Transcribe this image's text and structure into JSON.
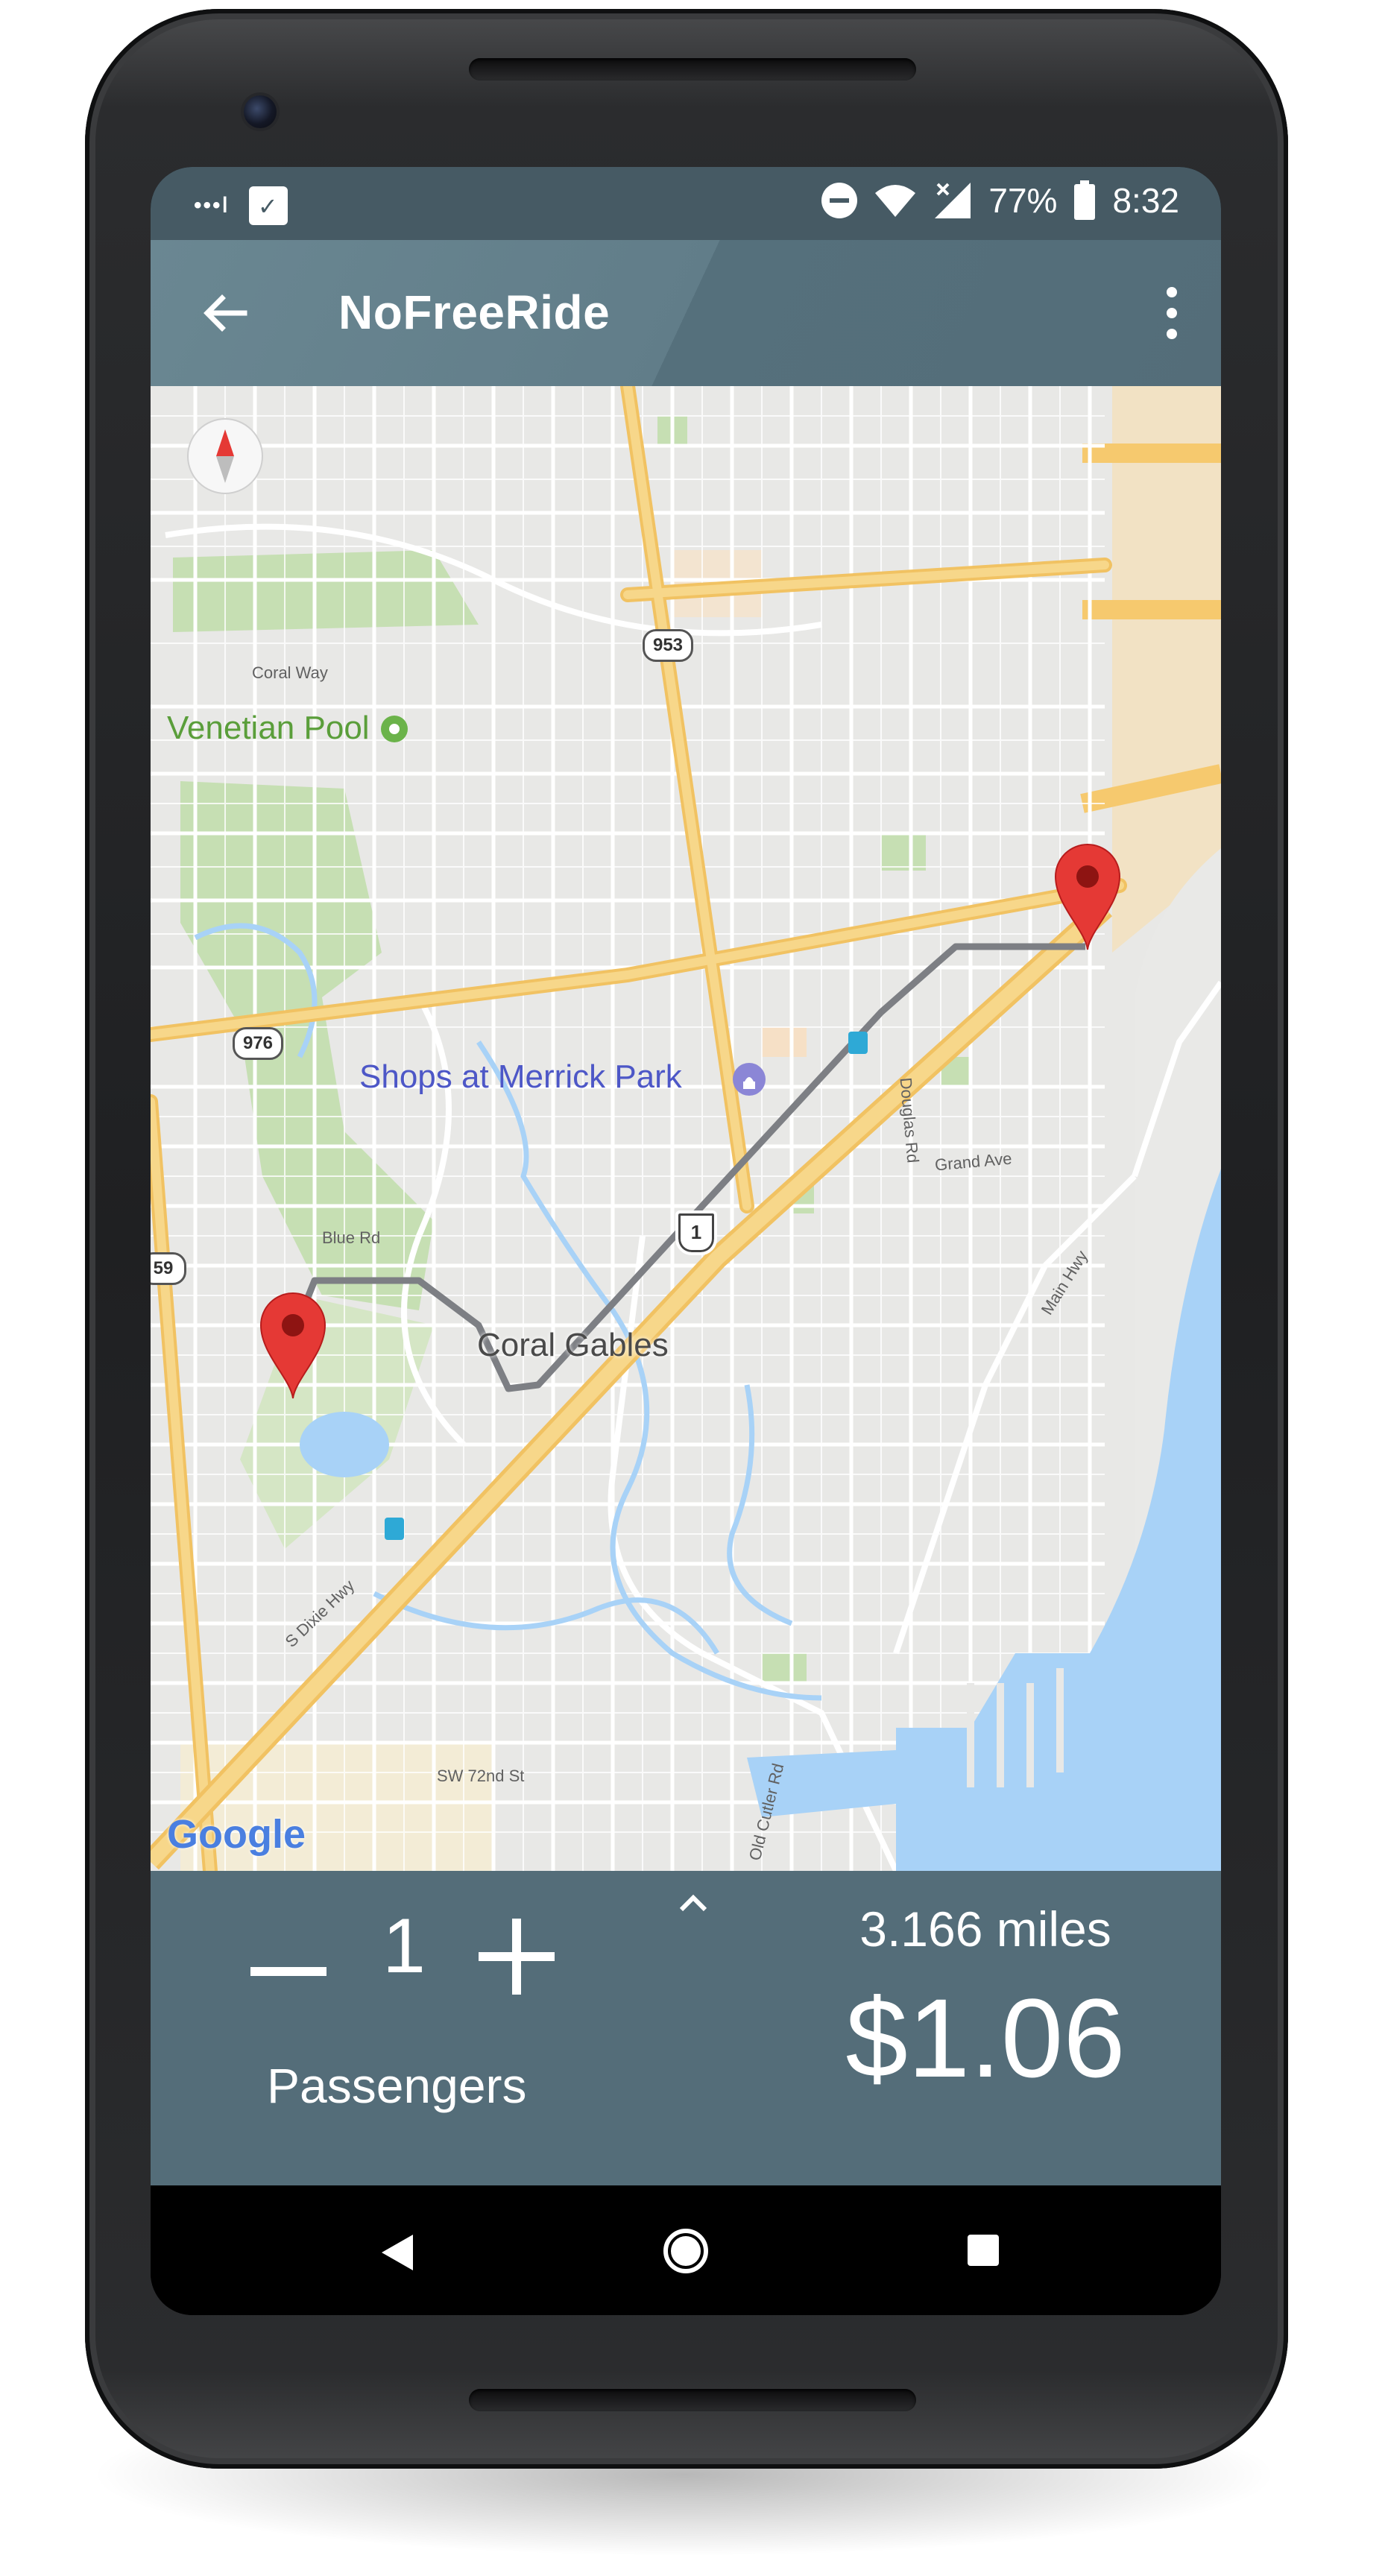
{
  "status_bar": {
    "signal_text": "•••ǀ",
    "battery_percent": "77%",
    "time": "8:32",
    "icons": [
      "signal-dots-icon",
      "checkbox-icon",
      "do-not-disturb-icon",
      "wifi-icon",
      "cell-signal-icon",
      "battery-icon"
    ]
  },
  "app_bar": {
    "title": "NoFreeRide",
    "back_icon": "arrow-back-icon",
    "menu_icon": "more-vert-icon"
  },
  "map": {
    "place_label": "Venetian Pool",
    "shop_label": "Shops at Merrick Park",
    "city_label": "Coral Gables",
    "streets": {
      "coral_way": "Coral Way",
      "blue_rd": "Blue Rd",
      "grand_ave": "Grand Ave",
      "douglas_rd": "Douglas Rd",
      "main_hwy": "Main Hwy",
      "dixie_hwy": "S Dixie Hwy",
      "sw72": "SW 72nd St",
      "old_cutler": "Old Cutler Rd"
    },
    "shields": {
      "r953": "953",
      "r976": "976",
      "r59": "59",
      "us1": "1"
    },
    "logo": "Google",
    "compass_icon": "compass-icon",
    "marker_icon": "map-pin-icon",
    "colors": {
      "route": "#7d7f84",
      "pin": "#e53935",
      "water": "#a8d2f7",
      "park": "#c6dfb3",
      "highway": "#f7d27a"
    }
  },
  "fare_panel": {
    "minus_icon": "minus-icon",
    "plus_icon": "plus-icon",
    "passenger_count": "1",
    "passengers_label": "Passengers",
    "expand_icon": "chevron-up-icon",
    "distance": "3.166 miles",
    "fare": "$1.06"
  },
  "nav_bar": {
    "back": "nav-back-icon",
    "home": "nav-home-icon",
    "recents": "nav-recents-icon"
  },
  "theme": {
    "primary": "#546d79",
    "status_bar": "#465a64"
  }
}
